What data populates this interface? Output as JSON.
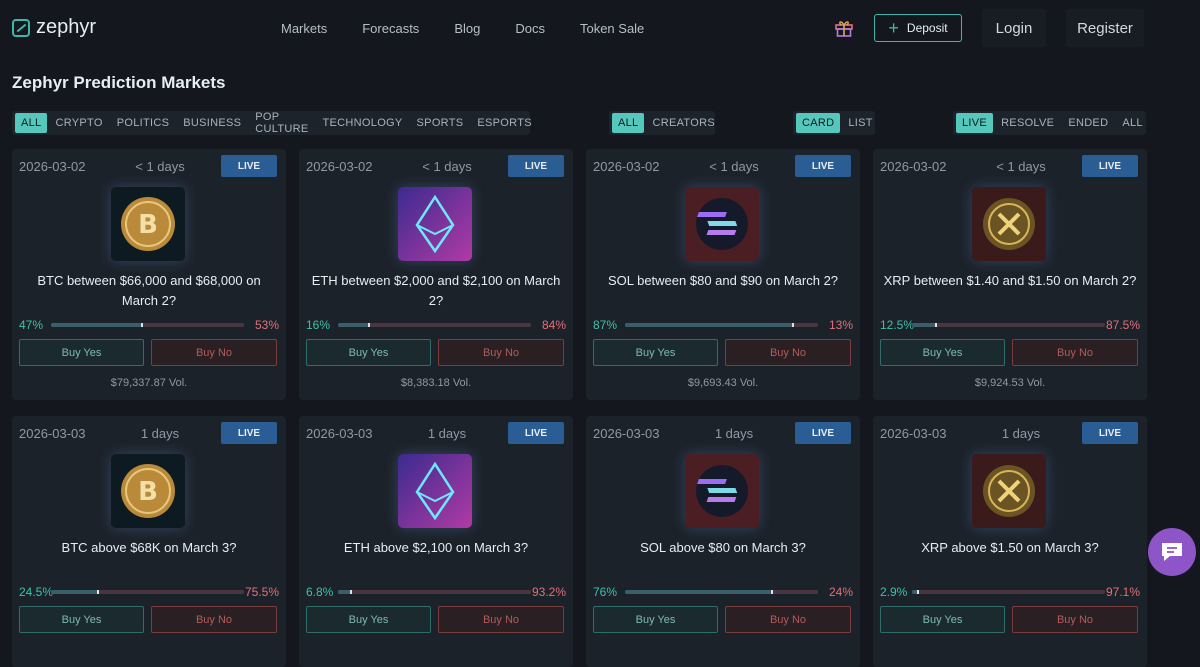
{
  "nav": {
    "logo_text": "zephyr",
    "links": [
      "Markets",
      "Forecasts",
      "Blog",
      "Docs",
      "Token Sale"
    ],
    "deposit_label": "Deposit",
    "login_label": "Login",
    "register_label": "Register"
  },
  "page_title": "Zephyr Prediction Markets",
  "filters": {
    "categories": [
      "ALL",
      "CRYPTO",
      "POLITICS",
      "BUSINESS",
      "POP CULTURE",
      "TECHNOLOGY",
      "SPORTS",
      "ESPORTS"
    ],
    "source": [
      "ALL",
      "CREATORS"
    ],
    "view": [
      "CARD",
      "LIST"
    ],
    "status": [
      "LIVE",
      "RESOLVE",
      "ENDED",
      "ALL"
    ]
  },
  "colors": {
    "accent": "#56c7bc",
    "live_badge": "#2b5d95",
    "yes": "#3fc1a9",
    "no": "#e0707a",
    "chat_bubble": "#8e55c9"
  },
  "cards": [
    {
      "date": "2026-03-02",
      "days": "< 1 days",
      "status": "LIVE",
      "coin": "BTC",
      "question": "BTC between $66,000 and $68,000 on March 2?",
      "yes_pct": "47%",
      "no_pct": "53%",
      "yes_ratio": 0.47,
      "buy_yes": "Buy Yes",
      "buy_no": "Buy No",
      "volume": "$79,337.87 Vol."
    },
    {
      "date": "2026-03-02",
      "days": "< 1 days",
      "status": "LIVE",
      "coin": "ETH",
      "question": "ETH between $2,000 and $2,100 on March 2?",
      "yes_pct": "16%",
      "no_pct": "84%",
      "yes_ratio": 0.16,
      "buy_yes": "Buy Yes",
      "buy_no": "Buy No",
      "volume": "$8,383.18 Vol."
    },
    {
      "date": "2026-03-02",
      "days": "< 1 days",
      "status": "LIVE",
      "coin": "SOL",
      "question": "SOL between $80 and $90 on March 2?",
      "yes_pct": "87%",
      "no_pct": "13%",
      "yes_ratio": 0.87,
      "buy_yes": "Buy Yes",
      "buy_no": "Buy No",
      "volume": "$9,693.43 Vol."
    },
    {
      "date": "2026-03-02",
      "days": "< 1 days",
      "status": "LIVE",
      "coin": "XRP",
      "question": "XRP between $1.40 and $1.50 on March 2?",
      "yes_pct": "12.5%",
      "no_pct": "87.5%",
      "yes_ratio": 0.125,
      "buy_yes": "Buy Yes",
      "buy_no": "Buy No",
      "volume": "$9,924.53 Vol."
    },
    {
      "date": "2026-03-03",
      "days": "1 days",
      "status": "LIVE",
      "coin": "BTC",
      "question": "BTC above $68K on March 3?",
      "yes_pct": "24.5%",
      "no_pct": "75.5%",
      "yes_ratio": 0.245,
      "buy_yes": "Buy Yes",
      "buy_no": "Buy No",
      "volume": ""
    },
    {
      "date": "2026-03-03",
      "days": "1 days",
      "status": "LIVE",
      "coin": "ETH",
      "question": "ETH above $2,100 on March 3?",
      "yes_pct": "6.8%",
      "no_pct": "93.2%",
      "yes_ratio": 0.068,
      "buy_yes": "Buy Yes",
      "buy_no": "Buy No",
      "volume": ""
    },
    {
      "date": "2026-03-03",
      "days": "1 days",
      "status": "LIVE",
      "coin": "SOL",
      "question": "SOL above $80 on March 3?",
      "yes_pct": "76%",
      "no_pct": "24%",
      "yes_ratio": 0.76,
      "buy_yes": "Buy Yes",
      "buy_no": "Buy No",
      "volume": ""
    },
    {
      "date": "2026-03-03",
      "days": "1 days",
      "status": "LIVE",
      "coin": "XRP",
      "question": "XRP above $1.50 on March 3?",
      "yes_pct": "2.9%",
      "no_pct": "97.1%",
      "yes_ratio": 0.029,
      "buy_yes": "Buy Yes",
      "buy_no": "Buy No",
      "volume": ""
    }
  ]
}
